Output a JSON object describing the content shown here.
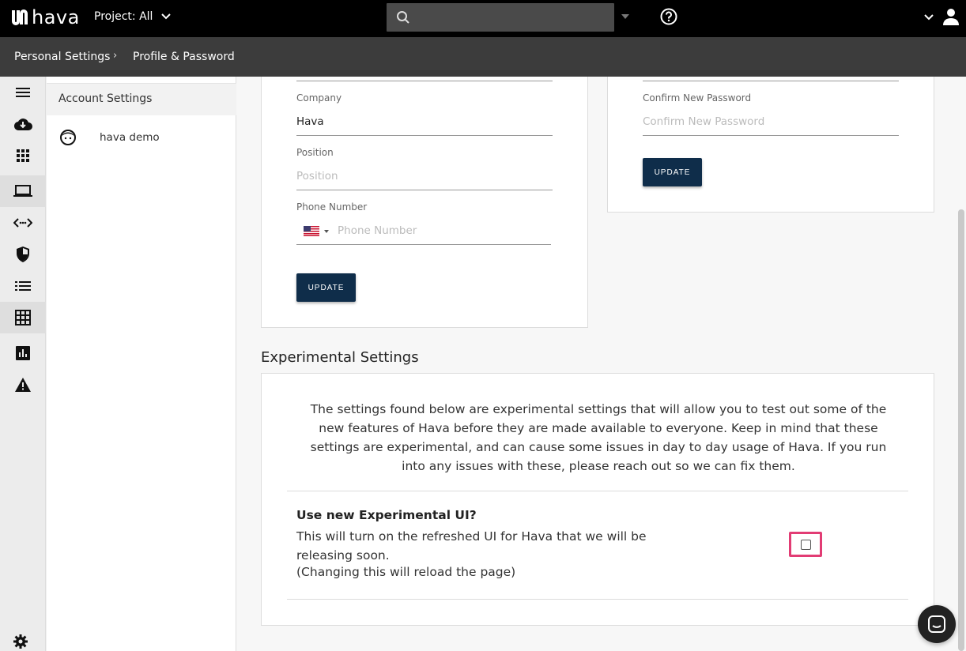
{
  "topbar": {
    "logo_text": "hava",
    "project_label": "Project: All",
    "search_placeholder": ""
  },
  "breadcrumb": {
    "items": [
      "Personal Settings",
      "Profile & Password"
    ],
    "separator": "›"
  },
  "rail": {
    "icons": [
      "menu-icon",
      "cloud-download-icon",
      "apps-grid-icon",
      "laptop-icon",
      "code-arrows-icon",
      "shield-icon",
      "list-icon",
      "table-grid-icon",
      "bar-chart-icon",
      "warning-icon",
      "settings-gear-icon"
    ]
  },
  "subnav": {
    "header": "Account Settings",
    "user_name": "hava demo"
  },
  "profile_form": {
    "company_label": "Company",
    "company_value": "Hava",
    "position_label": "Position",
    "position_placeholder": "Position",
    "phone_label": "Phone Number",
    "phone_placeholder": "Phone Number",
    "update_label": "UPDATE"
  },
  "password_form": {
    "confirm_label": "Confirm New Password",
    "confirm_placeholder": "Confirm New Password",
    "update_label": "UPDATE"
  },
  "experimental": {
    "title": "Experimental Settings",
    "description": "The settings found below are experimental settings that will allow you to test out some of the new features of Hava before they are made available to everyone. Keep in mind that these settings are experimental, and can cause some issues in day to day usage of Hava. If you run into any issues with these, please reach out so we can fix them.",
    "question": "Use new Experimental UI?",
    "detail": "This will turn on the refreshed UI for Hava that we will be releasing soon.",
    "note": "(Changing this will reload the page)",
    "checked": false
  },
  "colors": {
    "topbar": "#000000",
    "breadcrumb_bar": "#3c3c3c",
    "button": "#0f2d4a",
    "highlight": "#e23c74"
  }
}
